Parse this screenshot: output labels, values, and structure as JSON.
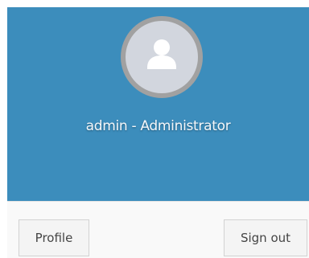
{
  "user_header": {
    "name": "admin - Administrator",
    "avatar_icon": "user-silhouette-icon",
    "background_color": "#3c8dbc"
  },
  "user_footer": {
    "profile_label": "Profile",
    "signout_label": "Sign out"
  }
}
